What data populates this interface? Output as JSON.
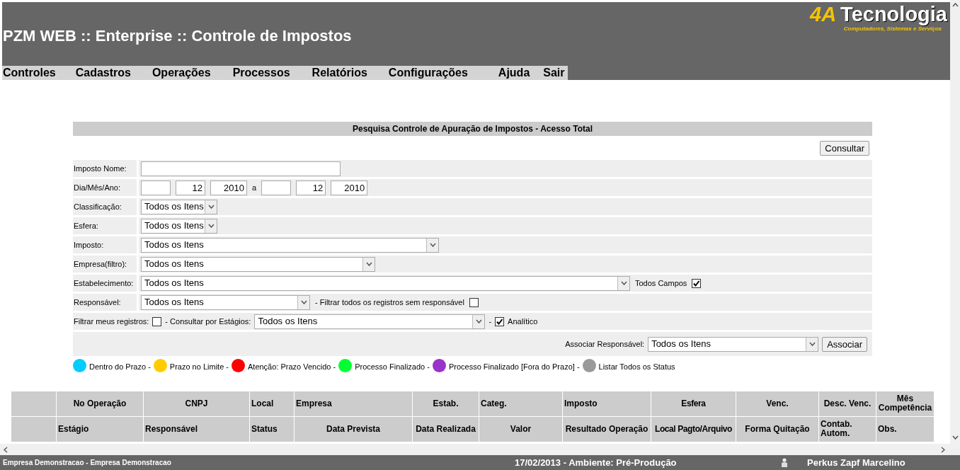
{
  "header": {
    "title": "PZM WEB :: Enterprise :: Controle de Impostos",
    "logo_mark": "4A",
    "logo_name": "Tecnologia",
    "logo_tagline": "Computadores, Sistemas e Serviços"
  },
  "menu": [
    "Controles",
    "Cadastros",
    "Operações",
    "Processos",
    "Relatórios",
    "Configurações",
    "Ajuda",
    "Sair"
  ],
  "search": {
    "title": "Pesquisa Controle de Apuração de Impostos - Acesso Total",
    "consult_button": "Consultar",
    "rows": [
      {
        "label": "Imposto Nome:",
        "items": [
          {
            "kind": "input"
          }
        ]
      },
      {
        "label": "Dia/Mês/Ano:",
        "items": [
          {
            "kind": "input"
          },
          {
            "kind": "input",
            "value": "12"
          },
          {
            "kind": "input",
            "value": "2010"
          },
          {
            "kind": "text",
            "text": "a"
          },
          {
            "kind": "input"
          },
          {
            "kind": "input",
            "value": "12"
          },
          {
            "kind": "input",
            "value": "2010"
          }
        ]
      },
      {
        "label": "Classificação:",
        "items": [
          {
            "kind": "select",
            "value": "Todos os Itens"
          }
        ]
      },
      {
        "label": "Esfera:",
        "items": [
          {
            "kind": "select",
            "value": "Todos os Itens"
          }
        ]
      },
      {
        "label": "Imposto:",
        "items": [
          {
            "kind": "select",
            "value": "Todos os Itens"
          }
        ]
      },
      {
        "label": "Empresa(filtro):",
        "items": [
          {
            "kind": "select",
            "value": "Todos os Itens"
          }
        ]
      },
      {
        "label": "Estabelecimento:",
        "items": [
          {
            "kind": "select",
            "value": "Todos os Itens"
          },
          {
            "kind": "text",
            "text": "Todos Campos"
          },
          {
            "kind": "checkbox",
            "checked": true
          }
        ]
      },
      {
        "label": "Responsável:",
        "items": [
          {
            "kind": "select",
            "value": "Todos os Itens"
          },
          {
            "kind": "text",
            "text": "- Filtrar todos os registros sem responsável"
          },
          {
            "kind": "checkbox",
            "checked": false
          }
        ]
      },
      {
        "items": [
          {
            "kind": "text",
            "text": "Filtrar meus registros:"
          },
          {
            "kind": "checkbox",
            "checked": false
          },
          {
            "kind": "text",
            "text": "- Consultar por Estágios:"
          },
          {
            "kind": "select",
            "value": "Todos os Itens"
          },
          {
            "kind": "text",
            "text": "-"
          },
          {
            "kind": "checkbox",
            "checked": true
          },
          {
            "kind": "text",
            "text": "Analítico"
          }
        ]
      },
      {
        "kind": "actions",
        "items": [
          {
            "kind": "text",
            "text": "Associar Responsável:"
          },
          {
            "kind": "select",
            "value": "Todos os Itens"
          },
          {
            "kind": "button",
            "text": "Associar"
          }
        ]
      }
    ]
  },
  "legend": [
    {
      "color": "#00ccff",
      "label": "Dentro do Prazo -"
    },
    {
      "color": "#ffcc00",
      "label": "Prazo no Limite -"
    },
    {
      "color": "#ff0000",
      "label": "Atenção: Prazo Vencido -"
    },
    {
      "color": "#00ff33",
      "label": "Processo Finalizado -"
    },
    {
      "color": "#9933cc",
      "label": "Processo Finalizado [Fora do Prazo] -"
    },
    {
      "color": "#999999",
      "label": "Listar Todos os Status"
    }
  ],
  "table": {
    "header_rows": [
      [
        "No Operação",
        "CNPJ",
        "Local",
        "Empresa",
        "Estab.",
        "Categ.",
        "Imposto",
        "Esfera",
        "Venc.",
        "Desc. Venc.",
        "Mês Competência"
      ],
      [
        "Estágio",
        "Responsável",
        "Status",
        "Data Prevista",
        "Data Realizada",
        "Valor",
        "Resultado Operação",
        "Local Pagto/Arquivo",
        "Forma Quitação",
        "Contab. Autom.",
        "Obs."
      ]
    ]
  },
  "status_bar": {
    "company": "Empresa Demonstracao - Empresa Demonstracao",
    "date_env": "17/02/2013 - Ambiente: Pré-Produção",
    "user": "Perkus Zapf Marcelino"
  }
}
